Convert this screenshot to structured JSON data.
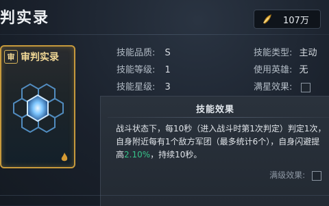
{
  "header": {
    "title": "判实录",
    "currency_amount": "107万"
  },
  "card": {
    "badge": "审",
    "title": "审判实录"
  },
  "info": {
    "quality_label": "技能品质:",
    "quality_value": "S",
    "level_label": "技能等级:",
    "level_value": "1",
    "star_label": "技能星级:",
    "star_value": "3",
    "type_label": "技能类型:",
    "type_value": "主动",
    "hero_label": "使用英雄:",
    "hero_value": "无",
    "fullstar_label": "满星效果:"
  },
  "effect": {
    "title": "技能效果",
    "line1": "战斗状态下，每10秒（进入战斗时第1次判定）判定1次，",
    "line2": "自身附近每有1个敌方军团（最多统计6个），自身闪避提",
    "line3_pre": "高",
    "line3_value": "2.10%",
    "line3_post": "，持续10秒。",
    "full_label": "满级效果:"
  },
  "colors": {
    "accent_gold": "#c79a3c",
    "highlight_green": "#37c48b"
  }
}
